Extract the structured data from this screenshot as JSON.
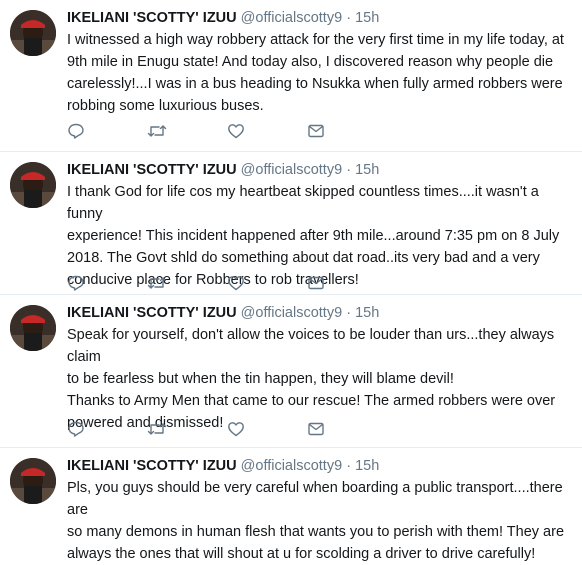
{
  "tweets": [
    {
      "name": "IKELIANI 'SCOTTY' IZUU",
      "handle": "@officialscotty9",
      "dot": "·",
      "time": "15h",
      "text": "I witnessed a high way robbery attack for the very first time in my life today, at\n9th mile in Enugu state! And today also, I discovered reason why people die\ncarelessly!...I was in a bus heading to Nsukka when fully armed robbers were\nrobbing some luxurious buses."
    },
    {
      "name": "IKELIANI 'SCOTTY' IZUU",
      "handle": "@officialscotty9",
      "dot": "·",
      "time": "15h",
      "text": "I thank God for life cos my heartbeat skipped countless times....it wasn't a funny\nexperience! This incident happened after 9th mile...around 7:35 pm on 8 July\n2018. The Govt shld do something about dat road..its very bad and a very\nconducive place for Robbers to rob travellers!"
    },
    {
      "name": "IKELIANI 'SCOTTY' IZUU",
      "handle": "@officialscotty9",
      "dot": "·",
      "time": "15h",
      "text": "Speak for yourself, don't allow the voices to be louder than urs...they always claim\nto be fearless but when the tin happen, they will blame devil!\nThanks to Army Men that came to our rescue! The armed robbers were over\npowered and dismissed!"
    },
    {
      "name": "IKELIANI 'SCOTTY' IZUU",
      "handle": "@officialscotty9",
      "dot": "·",
      "time": "15h",
      "text": "Pls, you guys should be very careful when boarding a public transport....there are\nso many demons in human flesh that wants you to perish with them! They are\nalways the ones that will shout at u for scolding a driver to drive carefully!"
    }
  ],
  "icons": [
    "reply-icon",
    "retweet-icon",
    "like-icon",
    "message-icon"
  ],
  "colors": {
    "text": "#14171a",
    "secondary": "#657786",
    "divider": "#e6ecf0"
  }
}
